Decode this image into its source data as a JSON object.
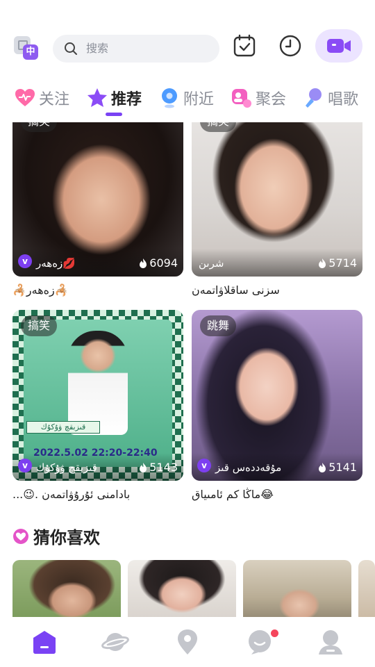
{
  "header": {
    "lang_badge": "中",
    "search_placeholder": "搜索"
  },
  "tabs": [
    {
      "label": "关注",
      "icon": "heart-icon",
      "active": false
    },
    {
      "label": "推荐",
      "icon": "star-icon",
      "active": true
    },
    {
      "label": "附近",
      "icon": "location-pin-icon",
      "active": false
    },
    {
      "label": "聚会",
      "icon": "party-icon",
      "active": false
    },
    {
      "label": "唱歌",
      "icon": "microphone-icon",
      "active": false
    }
  ],
  "feed": [
    {
      "tag": "搞笑",
      "host": "زەھەر💋",
      "views": "6094",
      "caption": "🦂زەھەر🦂"
    },
    {
      "tag": "搞笑",
      "host": "شرىن",
      "views": "5714",
      "caption": "سزنى ساقلاۋاتمەن"
    },
    {
      "tag": "搞笑",
      "host": "قىزبقچ ۋۇكۇك",
      "views": "5143",
      "caption": "...😉. بادامنى ئۇرۇۋاتمەن",
      "poster_name": "قىزبقچ ۋۇكۇك",
      "poster_date": "2022.5.02  22:20-22:40"
    },
    {
      "tag": "跳舞",
      "host": "مۇقەددەس قىز",
      "views": "5141",
      "caption": "ماڭا كم ئامىياق😂"
    }
  ],
  "guess": {
    "title": "猜你喜欢"
  },
  "bottom_nav": [
    {
      "icon": "home-icon",
      "active": true
    },
    {
      "icon": "planet-icon",
      "active": false
    },
    {
      "icon": "location-icon",
      "active": false
    },
    {
      "icon": "message-icon",
      "active": false,
      "badge": true
    },
    {
      "icon": "profile-icon",
      "active": false
    }
  ],
  "colors": {
    "accent": "#7a42f4",
    "badge": "#f5455c"
  }
}
